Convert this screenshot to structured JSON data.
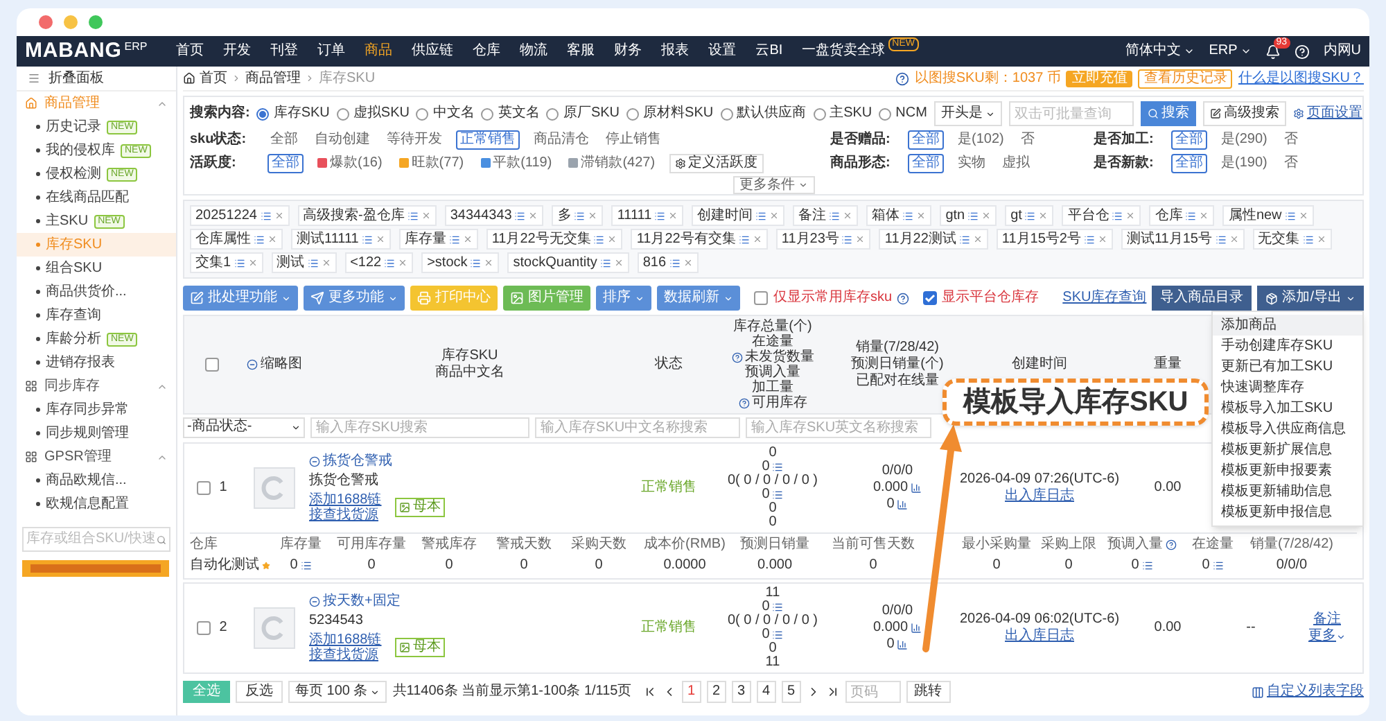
{
  "nav": {
    "logo": "MABANG",
    "logo_sub": "ERP",
    "items": [
      {
        "label": "首页",
        "selected": false
      },
      {
        "label": "开发",
        "selected": false
      },
      {
        "label": "刊登",
        "selected": false
      },
      {
        "label": "订单",
        "selected": false
      },
      {
        "label": "商品",
        "selected": true
      },
      {
        "label": "供应链",
        "selected": false
      },
      {
        "label": "仓库",
        "selected": false
      },
      {
        "label": "物流",
        "selected": false
      },
      {
        "label": "客服",
        "selected": false
      },
      {
        "label": "财务",
        "selected": false
      },
      {
        "label": "报表",
        "selected": false
      },
      {
        "label": "设置",
        "selected": false
      },
      {
        "label": "云BI",
        "selected": false
      },
      {
        "label": "一盘货卖全球",
        "selected": false,
        "badge": "NEW"
      }
    ],
    "language": "简体中文",
    "app": "ERP",
    "notifications": "93",
    "user": "内网U"
  },
  "sidebar": {
    "collapse_label": "折叠面板",
    "groups": [
      {
        "label": "商品管理",
        "kind": "goods",
        "selected": true,
        "expanded": true,
        "items": [
          {
            "label": "历史记录",
            "badge": "NEW",
            "selected": false
          },
          {
            "label": "我的侵权库",
            "badge": "NEW",
            "selected": false
          },
          {
            "label": "侵权检测",
            "badge": "NEW",
            "selected": false
          },
          {
            "label": "在线商品匹配",
            "selected": false
          },
          {
            "label": "主SKU",
            "badge": "NEW",
            "selected": false
          },
          {
            "label": "库存SKU",
            "selected": true
          },
          {
            "label": "组合SKU",
            "selected": false
          },
          {
            "label": "商品供货价...",
            "selected": false
          },
          {
            "label": "库存查询",
            "selected": false
          },
          {
            "label": "库龄分析",
            "badge": "NEW",
            "selected": false
          },
          {
            "label": "进销存报表",
            "selected": false
          }
        ]
      },
      {
        "label": "同步库存",
        "kind": "grid",
        "selected": false,
        "expanded": true,
        "items": [
          {
            "label": "库存同步异常",
            "selected": false
          },
          {
            "label": "同步规则管理",
            "selected": false
          }
        ]
      },
      {
        "label": "GPSR管理",
        "kind": "grid",
        "selected": false,
        "expanded": true,
        "items": [
          {
            "label": "商品欧规信...",
            "selected": false
          },
          {
            "label": "欧规信息配置",
            "selected": false
          }
        ]
      }
    ],
    "search_placeholder": "库存或组合SKU/快速"
  },
  "breadcrumb": [
    "首页",
    "商品管理",
    "库存SKU"
  ],
  "quota": {
    "text": "以图搜SKU剩：1037 币",
    "recharge": "立即充值",
    "history": "查看历史记录",
    "help_link": "什么是以图搜SKU？"
  },
  "search": {
    "label": "搜索内容:",
    "options": [
      {
        "label": "库存SKU",
        "selected": true
      },
      {
        "label": "虚拟SKU",
        "selected": false
      },
      {
        "label": "中文名",
        "selected": false
      },
      {
        "label": "英文名",
        "selected": false
      },
      {
        "label": "原厂SKU",
        "selected": false
      },
      {
        "label": "原材料SKU",
        "selected": false
      },
      {
        "label": "默认供应商",
        "selected": false
      },
      {
        "label": "主SKU",
        "selected": false
      },
      {
        "label": "NCM",
        "selected": false
      }
    ],
    "match": "开头是",
    "placeholder": "双击可批量查询",
    "search_button": "搜索",
    "advanced_button": "高级搜索",
    "page_settings": "页面设置"
  },
  "filters": [
    [
      {
        "label": "sku状态:",
        "options": [
          {
            "label": "全部",
            "selected": false
          },
          {
            "label": "自动创建",
            "selected": false
          },
          {
            "label": "等待开发",
            "selected": false
          },
          {
            "label": "正常销售",
            "selected": true
          },
          {
            "label": "商品清仓",
            "selected": false
          },
          {
            "label": "停止销售",
            "selected": false
          }
        ]
      },
      {
        "label": "是否赠品:",
        "options": [
          {
            "label": "全部",
            "selected": true
          },
          {
            "label": "是(102)",
            "selected": false
          },
          {
            "label": "否",
            "selected": false
          }
        ]
      },
      {
        "label": "是否加工:",
        "options": [
          {
            "label": "全部",
            "selected": true
          },
          {
            "label": "是(290)",
            "selected": false
          },
          {
            "label": "否",
            "selected": false
          }
        ]
      }
    ],
    [
      {
        "label": "活跃度:",
        "options": [
          {
            "label": "全部",
            "selected": true
          },
          {
            "label": "爆款(16)",
            "selected": false,
            "color": "#e8505b"
          },
          {
            "label": "旺款(77)",
            "selected": false,
            "color": "#f5a623"
          },
          {
            "label": "平款(119)",
            "selected": false,
            "color": "#4a8fe0"
          },
          {
            "label": "滞销款(427)",
            "selected": false,
            "color": "#9aa3ad"
          }
        ],
        "action": "定义活跃度"
      },
      {
        "label": "商品形态:",
        "options": [
          {
            "label": "全部",
            "selected": true
          },
          {
            "label": "实物",
            "selected": false
          },
          {
            "label": "虚拟",
            "selected": false
          }
        ]
      },
      {
        "label": "是否新款:",
        "options": [
          {
            "label": "全部",
            "selected": true
          },
          {
            "label": "是(190)",
            "selected": false
          },
          {
            "label": "否",
            "selected": false
          }
        ]
      }
    ]
  ],
  "more_conditions": "更多条件",
  "saved_searches": [
    "20251224",
    "高级搜索-盈仓库",
    "34344343",
    "多",
    "11111",
    "创建时间",
    "备注",
    "箱体",
    "gtn",
    "gt",
    "平台仓",
    "仓库",
    "属性new",
    "仓库属性",
    "测试11111",
    "库存量",
    "11月22号无交集",
    "11月22号有交集",
    "11月23号",
    "11月22测试",
    "11月15号2号",
    "测试11月15号",
    "无交集",
    "交集1",
    "测试",
    "<122",
    ">stock",
    "stockQuantity",
    "816"
  ],
  "toolbar": {
    "buttons": [
      {
        "label": "批处理功能",
        "color": "#5b8fd8",
        "caret": true
      },
      {
        "label": "更多功能",
        "color": "#5b8fd8",
        "caret": true
      },
      {
        "label": "打印中心",
        "color": "#f4c430",
        "caret": false
      },
      {
        "label": "图片管理",
        "color": "#6dbb55",
        "caret": false
      },
      {
        "label": "排序",
        "color": "#5b8fd8",
        "caret": true
      },
      {
        "label": "数据刷新",
        "color": "#5b8fd8",
        "caret": true
      }
    ],
    "checks": [
      {
        "label": "仅显示常用库存sku",
        "checked": false,
        "help": true
      },
      {
        "label": "显示平台仓库存",
        "checked": true,
        "help": false
      }
    ],
    "link": "SKU库存查询",
    "import_button": "导入商品目录",
    "export_button": "添加/导出"
  },
  "table": {
    "header_checked": false,
    "thumb_header": "缩略图",
    "sku_header": [
      "库存SKU",
      "商品中文名"
    ],
    "status_header": "状态",
    "stock_header": [
      {
        "text": "库存总量(个)",
        "help": false
      },
      {
        "text": "在途量",
        "help": false
      },
      {
        "text": "未发货数量",
        "help": true
      },
      {
        "text": "预调入量",
        "help": false
      },
      {
        "text": "加工量",
        "help": false
      },
      {
        "text": "可用库存",
        "help": true
      }
    ],
    "sales_header": [
      "销量(7/28/42)",
      "预测日销量(个)",
      "已配对在线量"
    ],
    "created_header": "创建时间",
    "weight_header": "重量",
    "filter_row": {
      "status_select": "-商品状态-",
      "placeholders": [
        "输入库存SKU搜索",
        "输入库存SKU中文名称搜索",
        "输入库存SKU英文名称搜索"
      ]
    },
    "rows": [
      {
        "checked": false,
        "index": "1",
        "name": "拣货仓警戒",
        "subtitle": "拣货仓警戒",
        "link": "添加1688链接查找货源",
        "tag": "母本",
        "status": "正常销售",
        "stock": [
          {
            "text": "0",
            "detail_icon": false
          },
          {
            "text": "0",
            "detail_icon": true
          },
          {
            "text": "0( 0 / 0 / 0 / 0 )",
            "detail_icon": false
          },
          {
            "text": "0",
            "detail_icon": true
          },
          {
            "text": "0",
            "detail_icon": false
          },
          {
            "text": "0",
            "detail_icon": false
          }
        ],
        "sales": [
          {
            "text": "0/0/0",
            "chart_icon": false
          },
          {
            "text": "0.000",
            "chart_icon": true
          },
          {
            "text": "0",
            "chart_icon": true
          }
        ],
        "created": "2026-04-09 07:26(UTC-6)",
        "log_link": "出入库日志",
        "weight": "0.00",
        "actions": [],
        "detail": {
          "columns": [
            {
              "text": "仓库",
              "help": false
            },
            {
              "text": "库存量",
              "help": false
            },
            {
              "text": "可用库存量",
              "help": false
            },
            {
              "text": "警戒库存",
              "help": false
            },
            {
              "text": "警戒天数",
              "help": false
            },
            {
              "text": "采购天数",
              "help": false
            },
            {
              "text": "成本价(RMB)",
              "help": false
            },
            {
              "text": "预测日销量",
              "help": false
            },
            {
              "text": "当前可售天数",
              "help": false
            },
            {
              "text": "最小采购量",
              "help": false
            },
            {
              "text": "采购上限",
              "help": false
            },
            {
              "text": "预调入量",
              "help": true
            },
            {
              "text": "在途量",
              "help": false
            },
            {
              "text": "销量(7/28/42)",
              "help": false
            }
          ],
          "values": [
            {
              "text": "自动化测试",
              "star": true,
              "detail_icon": false
            },
            {
              "text": "0",
              "star": false,
              "detail_icon": true
            },
            {
              "text": "0",
              "star": false,
              "detail_icon": false
            },
            {
              "text": "0",
              "star": false,
              "detail_icon": false
            },
            {
              "text": "0",
              "star": false,
              "detail_icon": false
            },
            {
              "text": "0",
              "star": false,
              "detail_icon": false
            },
            {
              "text": "0.0000",
              "star": false,
              "detail_icon": false
            },
            {
              "text": "0.000",
              "star": false,
              "detail_icon": false
            },
            {
              "text": "0",
              "star": false,
              "detail_icon": false
            },
            {
              "text": "0",
              "star": false,
              "detail_icon": false
            },
            {
              "text": "0",
              "star": false,
              "detail_icon": false
            },
            {
              "text": "0",
              "star": false,
              "detail_icon": true
            },
            {
              "text": "0",
              "star": false,
              "detail_icon": true
            },
            {
              "text": "0/0/0",
              "star": false,
              "detail_icon": false
            }
          ]
        }
      },
      {
        "checked": false,
        "index": "2",
        "name": "按天数+固定",
        "subtitle": "5234543",
        "link": "添加1688链接查找货源",
        "tag": "母本",
        "status": "正常销售",
        "stock": [
          {
            "text": "11",
            "detail_icon": false
          },
          {
            "text": "0",
            "detail_icon": true
          },
          {
            "text": "0( 0 / 0 / 0 / 0 )",
            "detail_icon": false
          },
          {
            "text": "0",
            "detail_icon": true
          },
          {
            "text": "0",
            "detail_icon": false
          },
          {
            "text": "11",
            "detail_icon": false
          }
        ],
        "sales": [
          {
            "text": "0/0/0",
            "chart_icon": false
          },
          {
            "text": "0.000",
            "chart_icon": true
          },
          {
            "text": "0",
            "chart_icon": true
          }
        ],
        "created": "2026-04-09 06:02(UTC-6)",
        "log_link": "出入库日志",
        "weight": "0.00",
        "supplier": "--",
        "actions": [
          "备注",
          "更多"
        ]
      }
    ]
  },
  "pagination": {
    "select_all": "全选",
    "invert": "反选",
    "page_size": "每页 100 条",
    "summary": "共11406条 当前显示第1-100条 1/115页",
    "pages": [
      {
        "label": "1",
        "selected": true
      },
      {
        "label": "2",
        "selected": false
      },
      {
        "label": "3",
        "selected": false
      },
      {
        "label": "4",
        "selected": false
      },
      {
        "label": "5",
        "selected": false
      }
    ],
    "page_placeholder": "页码",
    "jump": "跳转",
    "custom_fields": "自定义列表字段"
  },
  "dropdown": [
    {
      "label": "添加商品",
      "selected": true
    },
    {
      "label": "手动创建库存SKU",
      "selected": false
    },
    {
      "label": "更新已有加工SKU",
      "selected": false
    },
    {
      "label": "快速调整库存",
      "selected": false
    },
    {
      "label": "模板导入加工SKU",
      "selected": false
    },
    {
      "label": "模板导入供应商信息",
      "selected": false
    },
    {
      "label": "模板更新扩展信息",
      "selected": false
    },
    {
      "label": "模板更新申报要素",
      "selected": false
    },
    {
      "label": "模板更新辅助信息",
      "selected": false
    },
    {
      "label": "模板更新申报信息",
      "selected": false
    }
  ],
  "callout": "模板导入库存SKU"
}
